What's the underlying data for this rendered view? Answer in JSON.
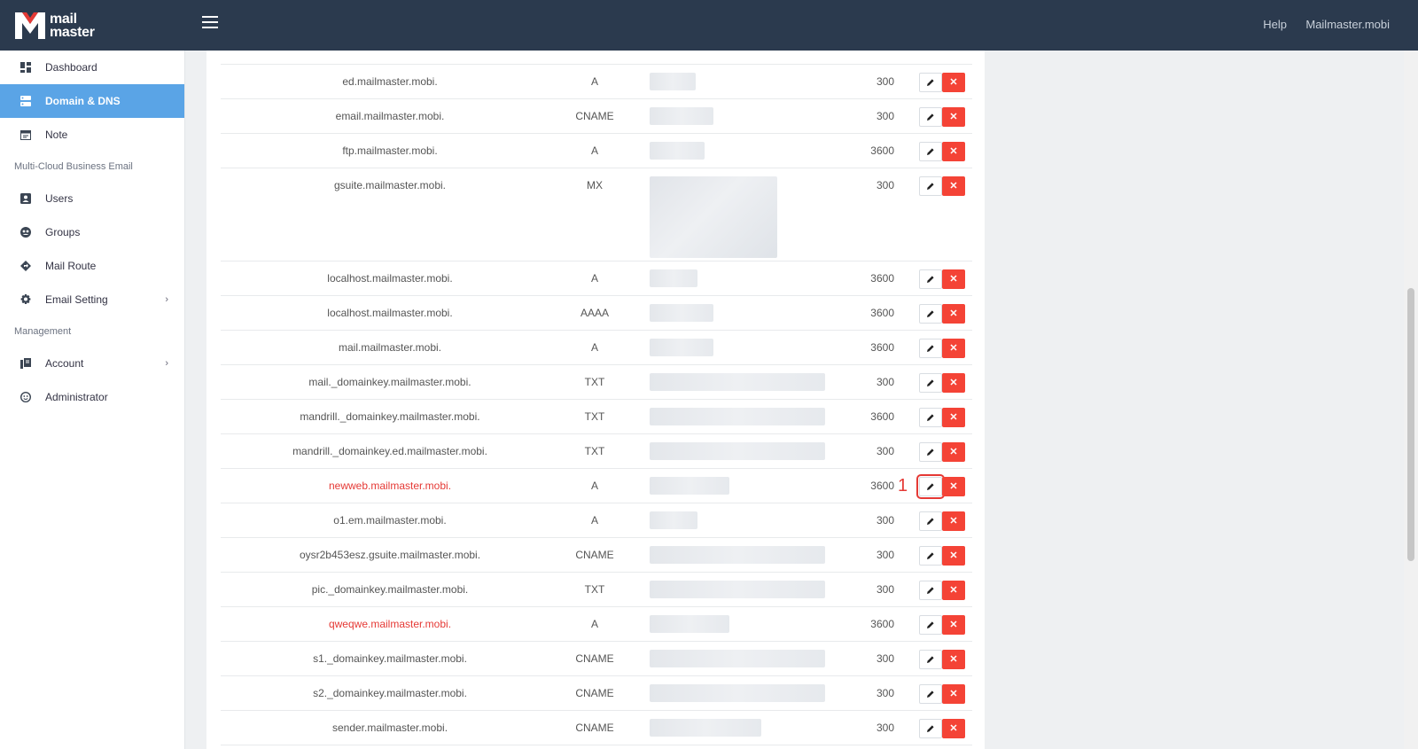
{
  "header": {
    "logo_line1": "mail",
    "logo_line2": "master",
    "help": "Help",
    "user": "Mailmaster.mobi"
  },
  "sidebar": {
    "items_top": [
      {
        "label": "Dashboard",
        "icon": "dashboard-icon"
      },
      {
        "label": "Domain & DNS",
        "icon": "dns-icon",
        "active": true
      },
      {
        "label": "Note",
        "icon": "note-icon"
      }
    ],
    "section_email": "Multi-Cloud Business Email",
    "items_email": [
      {
        "label": "Users",
        "icon": "user-icon"
      },
      {
        "label": "Groups",
        "icon": "groups-icon"
      },
      {
        "label": "Mail Route",
        "icon": "route-icon"
      },
      {
        "label": "Email Setting",
        "icon": "gear-icon"
      }
    ],
    "section_mgmt": "Management",
    "items_mgmt": [
      {
        "label": "Account",
        "icon": "account-icon"
      },
      {
        "label": "Administrator",
        "icon": "admin-icon"
      }
    ]
  },
  "dns": {
    "rows": [
      {
        "name": "ed.mailmaster.mobi.",
        "type": "A",
        "ttl": "300"
      },
      {
        "name": "email.mailmaster.mobi.",
        "type": "CNAME",
        "ttl": "300"
      },
      {
        "name": "ftp.mailmaster.mobi.",
        "type": "A",
        "ttl": "3600"
      },
      {
        "name": "gsuite.mailmaster.mobi.",
        "type": "MX",
        "ttl": "300"
      },
      {
        "name": "localhost.mailmaster.mobi.",
        "type": "A",
        "ttl": "3600"
      },
      {
        "name": "localhost.mailmaster.mobi.",
        "type": "AAAA",
        "ttl": "3600"
      },
      {
        "name": "mail.mailmaster.mobi.",
        "type": "A",
        "ttl": "3600"
      },
      {
        "name": "mail._domainkey.mailmaster.mobi.",
        "type": "TXT",
        "ttl": "300"
      },
      {
        "name": "mandrill._domainkey.mailmaster.mobi.",
        "type": "TXT",
        "ttl": "3600"
      },
      {
        "name": "mandrill._domainkey.ed.mailmaster.mobi.",
        "type": "TXT",
        "ttl": "300"
      },
      {
        "name": "newweb.mailmaster.mobi.",
        "type": "A",
        "ttl": "3600",
        "red": true
      },
      {
        "name": "o1.em.mailmaster.mobi.",
        "type": "A",
        "ttl": "300"
      },
      {
        "name": "oysr2b453esz.gsuite.mailmaster.mobi.",
        "type": "CNAME",
        "ttl": "300"
      },
      {
        "name": "pic._domainkey.mailmaster.mobi.",
        "type": "TXT",
        "ttl": "300"
      },
      {
        "name": "qweqwe.mailmaster.mobi.",
        "type": "A",
        "ttl": "3600",
        "red": true
      },
      {
        "name": "s1._domainkey.mailmaster.mobi.",
        "type": "CNAME",
        "ttl": "300"
      },
      {
        "name": "s2._domainkey.mailmaster.mobi.",
        "type": "CNAME",
        "ttl": "300"
      },
      {
        "name": "sender.mailmaster.mobi.",
        "type": "CNAME",
        "ttl": "300"
      }
    ],
    "annotation": "1",
    "highlight_color": "#e53935",
    "delete_color": "#f44336",
    "accent_color": "#5aa4e6"
  }
}
